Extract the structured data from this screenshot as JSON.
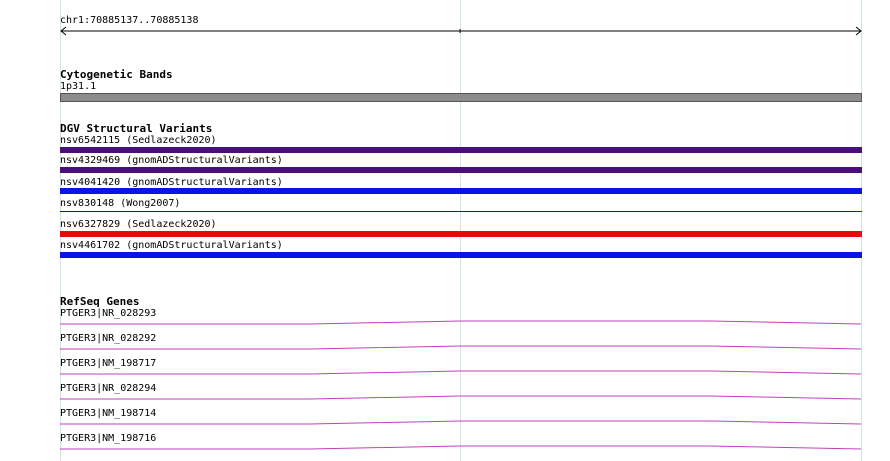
{
  "ruler": {
    "label": "chr1:70885137..70885138"
  },
  "cytoband": {
    "title": "Cytogenetic Bands",
    "label": "1p31.1",
    "color": "#8c8c8c"
  },
  "dgv": {
    "title": "DGV Structural Variants",
    "items": [
      {
        "label": "nsv6542115 (Sedlazeck2020)",
        "color": "#4b0f7a",
        "style": "thick"
      },
      {
        "label": "nsv4329469 (gnomADStructuralVariants)",
        "color": "#4b0f7a",
        "style": "thick"
      },
      {
        "label": "nsv4041420 (gnomADStructuralVariants)",
        "color": "#0a14e6",
        "style": "thick"
      },
      {
        "label": "nsv830148 (Wong2007)",
        "color": "#0a14e6",
        "style": "thin"
      },
      {
        "label": "nsv6327829 (Sedlazeck2020)",
        "color": "#e60a0a",
        "style": "thick"
      },
      {
        "label": "nsv4461702 (gnomADStructuralVariants)",
        "color": "#0a14e6",
        "style": "thick"
      }
    ]
  },
  "refseq": {
    "title": "RefSeq Genes",
    "line_color": "#c040c0",
    "items": [
      {
        "label": "PTGER3|NR_028293"
      },
      {
        "label": "PTGER3|NR_028292"
      },
      {
        "label": "PTGER3|NM_198717"
      },
      {
        "label": "PTGER3|NR_028294"
      },
      {
        "label": "PTGER3|NM_198714"
      },
      {
        "label": "PTGER3|NM_198716"
      }
    ]
  }
}
